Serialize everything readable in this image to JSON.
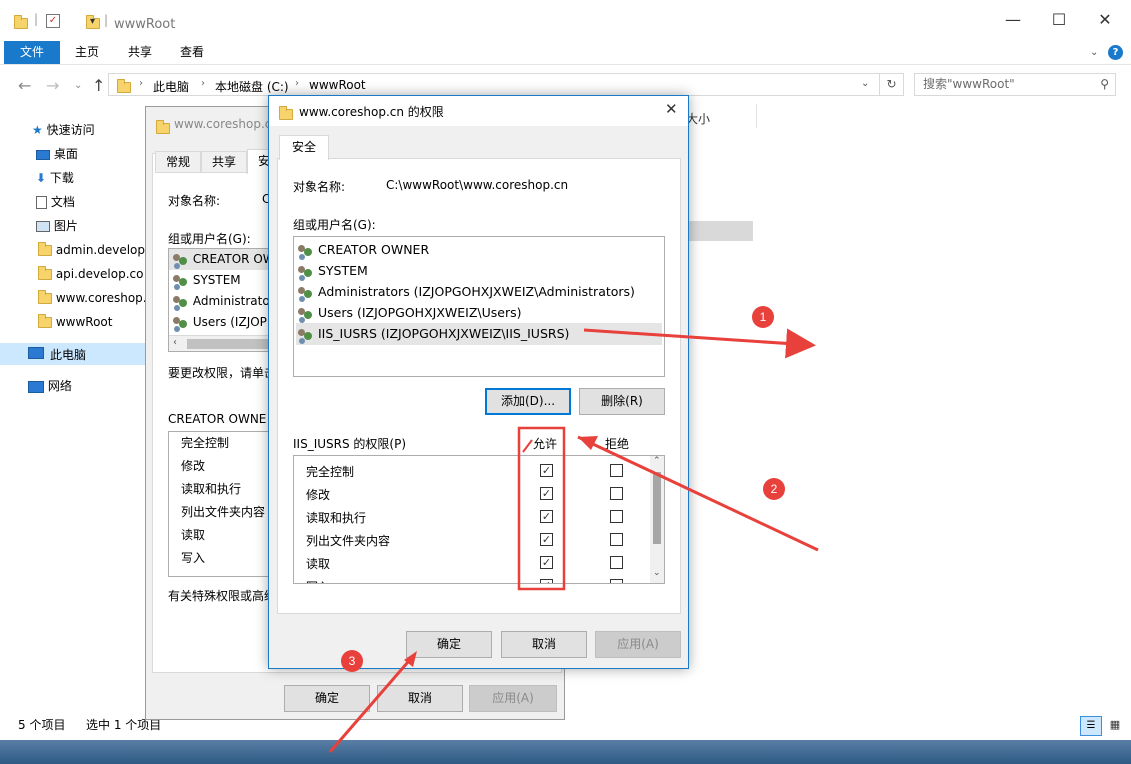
{
  "explorer": {
    "title": "wwwRoot",
    "ribbon": {
      "file": "文件",
      "home": "主页",
      "share": "共享",
      "view": "查看"
    },
    "address": {
      "root": "此电脑",
      "drive": "本地磁盘 (C:)",
      "folder": "wwwRoot"
    },
    "search_placeholder": "搜索\"wwwRoot\"",
    "column_header": "大小",
    "sidebar": [
      {
        "label": "快速访问",
        "icon": "star-icon"
      },
      {
        "label": "桌面",
        "icon": "desktop-icon"
      },
      {
        "label": "下载",
        "icon": "download-icon"
      },
      {
        "label": "文档",
        "icon": "document-icon"
      },
      {
        "label": "图片",
        "icon": "picture-icon"
      },
      {
        "label": "admin.develop",
        "icon": "folder-icon"
      },
      {
        "label": "api.develop.co",
        "icon": "folder-icon"
      },
      {
        "label": "www.coreshop.",
        "icon": "folder-icon"
      },
      {
        "label": "wwwRoot",
        "icon": "folder-icon"
      },
      {
        "label": "此电脑",
        "icon": "computer-icon"
      },
      {
        "label": "网络",
        "icon": "network-icon"
      }
    ],
    "status": {
      "count": "5 个项目",
      "selected": "选中 1 个项目"
    }
  },
  "props_dialog": {
    "title": "www.coreshop.cn",
    "tabs": [
      "常规",
      "共享",
      "安全"
    ],
    "object_label": "对象名称:",
    "object_value": "C",
    "group_label": "组或用户名(G):",
    "users": [
      "CREATOR OWN",
      "SYSTEM",
      "Administrator",
      "Users (IZJOP"
    ],
    "change_hint": "要更改权限，请单击",
    "perm_title": "CREATOR OWNE",
    "perms": [
      "完全控制",
      "修改",
      "读取和执行",
      "列出文件夹内容",
      "读取",
      "写入"
    ],
    "special_hint": "有关特殊权限或高级",
    "ok": "确定",
    "cancel": "取消",
    "apply": "应用(A)"
  },
  "perm_dialog": {
    "title": "www.coreshop.cn 的权限",
    "tab": "安全",
    "object_label": "对象名称:",
    "object_value": "C:\\wwwRoot\\www.coreshop.cn",
    "group_label": "组或用户名(G):",
    "users": [
      "CREATOR OWNER",
      "SYSTEM",
      "Administrators (IZJOPGOHXJXWEIZ\\Administrators)",
      "Users (IZJOPGOHXJXWEIZ\\Users)",
      "IIS_IUSRS (IZJOPGOHXJXWEIZ\\IIS_IUSRS)"
    ],
    "add": "添加(D)...",
    "remove": "删除(R)",
    "perm_label": "IIS_IUSRS 的权限(P)",
    "allow": "允许",
    "deny": "拒绝",
    "perms": [
      {
        "name": "完全控制",
        "allow": "✓",
        "deny": ""
      },
      {
        "name": "修改",
        "allow": "✓",
        "deny": ""
      },
      {
        "name": "读取和执行",
        "allow": "✓",
        "deny": ""
      },
      {
        "name": "列出文件夹内容",
        "allow": "✓",
        "deny": ""
      },
      {
        "name": "读取",
        "allow": "✓",
        "deny": ""
      },
      {
        "name": "写入",
        "allow": "✓",
        "deny": ""
      }
    ],
    "ok": "确定",
    "cancel": "取消",
    "apply": "应用(A)"
  },
  "annotations": [
    "1",
    "2",
    "3"
  ],
  "colors": {
    "accent": "#1979ca",
    "annotation": "#e8403b"
  }
}
